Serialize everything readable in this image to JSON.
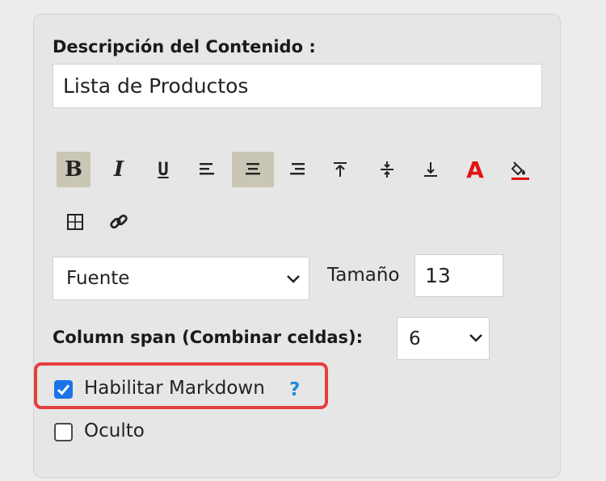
{
  "content": {
    "label": "Descripción del Contenido :",
    "value": "Lista de Productos"
  },
  "toolbar": {
    "bold": "B",
    "italic": "I",
    "underline": "U",
    "font_color": "A",
    "active_buttons": [
      "bold",
      "align-center"
    ],
    "icons": [
      "bold-icon",
      "italic-icon",
      "underline-icon",
      "align-left-icon",
      "align-center-icon",
      "align-right-icon",
      "valign-top-icon",
      "valign-middle-icon",
      "valign-bottom-icon",
      "font-color-icon",
      "fill-color-icon",
      "table-icon",
      "link-icon"
    ],
    "active_color": "#c9c6b6",
    "font_color_value": "#e01515"
  },
  "font": {
    "selected": "Fuente",
    "size_label": "Tamaño",
    "size_value": "13"
  },
  "span": {
    "label": "Column span (Combinar celdas):",
    "selected": "6"
  },
  "options": {
    "markdown_label": "Habilitar Markdown",
    "markdown_checked": true,
    "help": "?",
    "hidden_label": "Oculto",
    "hidden_checked": false,
    "highlight_color": "#e53e3e"
  }
}
